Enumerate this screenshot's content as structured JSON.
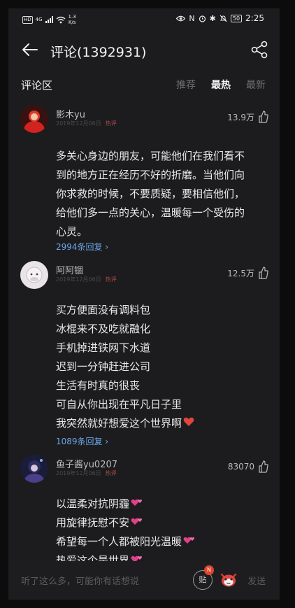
{
  "status": {
    "network": "4G",
    "speed_value": "1.3",
    "speed_unit": "K/s",
    "battery": "50",
    "time": "2:25"
  },
  "header": {
    "title": "评论(1392931)"
  },
  "section": {
    "label": "评论区",
    "sorts": [
      "推荐",
      "最热",
      "最新"
    ],
    "active_sort": "最热"
  },
  "comments": [
    {
      "name": "影木yu",
      "date": "2019年12月06日",
      "hot_tag": "热评",
      "likes": "13.9万",
      "lines": [
        "多关心身边的朋友，可能他们在我们看不",
        "到的地方正在经历不好的折磨。当他们向",
        "你求救的时候，不要质疑，要相信他们，",
        "给他们多一点的关心，温暖每一个受伤的",
        "心灵。"
      ],
      "replies": "2994条回复"
    },
    {
      "name": "阿阿锢",
      "date": "2019年12月06日",
      "hot_tag": "热评",
      "likes": "12.5万",
      "lines": [
        "买方便面没有调料包",
        "冰棍来不及吃就融化",
        "手机掉进铁网下水道",
        "迟到一分钟赶进公司",
        "生活有时真的很丧",
        "可自从你出现在平凡日子里",
        "我突然就好想爱这个世界啊"
      ],
      "replies": "1089条回复"
    },
    {
      "name": "鱼子酱yu0207",
      "date": "2019年12月06日",
      "hot_tag": "热评",
      "likes": "83070",
      "lines": [
        "以温柔对抗阴霾",
        "用旋律抚慰不安",
        "希望每一个人都被阳光温暖",
        "热爱这个是世界"
      ]
    }
  ],
  "bottom": {
    "placeholder": "听了这么多，可能你有话想说",
    "tie_label": "贴",
    "tie_badge": "N",
    "send": "发送"
  }
}
